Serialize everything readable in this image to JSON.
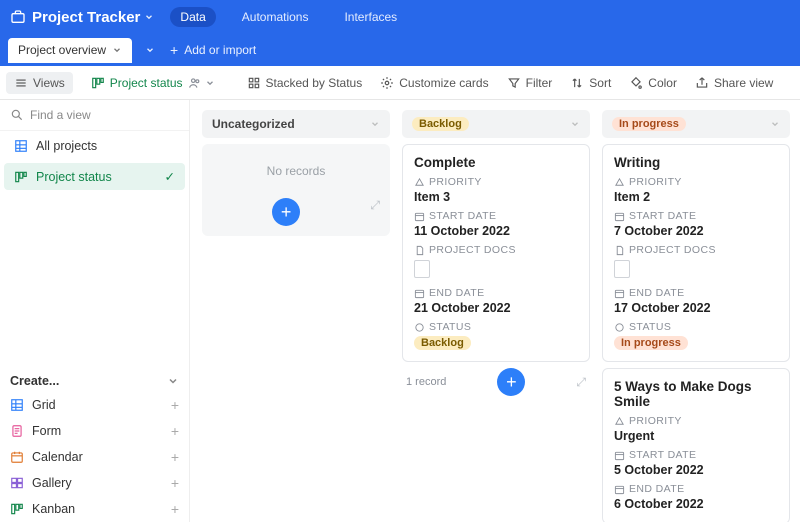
{
  "header": {
    "title": "Project Tracker",
    "tabs": [
      {
        "label": "Data",
        "active": true
      },
      {
        "label": "Automations",
        "active": false
      },
      {
        "label": "Interfaces",
        "active": false
      }
    ],
    "table_tab": "Project overview",
    "add_or_import": "Add or import"
  },
  "toolbar": {
    "views": "Views",
    "project_status": "Project status",
    "stacked_by": "Stacked by Status",
    "customize": "Customize cards",
    "filter": "Filter",
    "sort": "Sort",
    "color": "Color",
    "share": "Share view"
  },
  "sidebar": {
    "search_placeholder": "Find a view",
    "items": [
      {
        "label": "All projects",
        "icon": "grid",
        "color": "ic-blue",
        "active": false
      },
      {
        "label": "Project status",
        "icon": "kanban",
        "color": "ic-green",
        "active": true
      }
    ],
    "create_label": "Create...",
    "create_items": [
      {
        "label": "Grid",
        "icon": "grid",
        "color": "ic-blue"
      },
      {
        "label": "Form",
        "icon": "form",
        "color": "ic-pink"
      },
      {
        "label": "Calendar",
        "icon": "calendar",
        "color": "ic-orange"
      },
      {
        "label": "Gallery",
        "icon": "gallery",
        "color": "ic-purple"
      },
      {
        "label": "Kanban",
        "icon": "kanban",
        "color": "ic-green"
      }
    ]
  },
  "board": {
    "columns": [
      {
        "key": "uncat",
        "title": "Uncategorized",
        "tag_class": "",
        "empty_text": "No records",
        "cards": []
      },
      {
        "key": "backlog",
        "title": "Backlog",
        "tag_class": "tag-backlog",
        "footer_count": "1 record",
        "cards": [
          {
            "title": "Complete",
            "priority": "Item 3",
            "start_date": "11 October 2022",
            "end_date": "21 October 2022",
            "status": "Backlog",
            "status_class": "tag-backlog"
          }
        ]
      },
      {
        "key": "inprogress",
        "title": "In progress",
        "tag_class": "tag-inprogress",
        "cards": [
          {
            "title": "Writing",
            "priority": "Item 2",
            "start_date": "7 October 2022",
            "end_date": "17 October 2022",
            "status": "In progress",
            "status_class": "tag-inprogress"
          },
          {
            "title": "5 Ways to Make Dogs Smile",
            "priority": "Urgent",
            "start_date": "5 October 2022",
            "end_date": "6 October 2022"
          }
        ]
      }
    ],
    "field_labels": {
      "priority": "PRIORITY",
      "start_date": "START DATE",
      "project_docs": "PROJECT DOCS",
      "end_date": "END DATE",
      "status": "STATUS"
    }
  }
}
